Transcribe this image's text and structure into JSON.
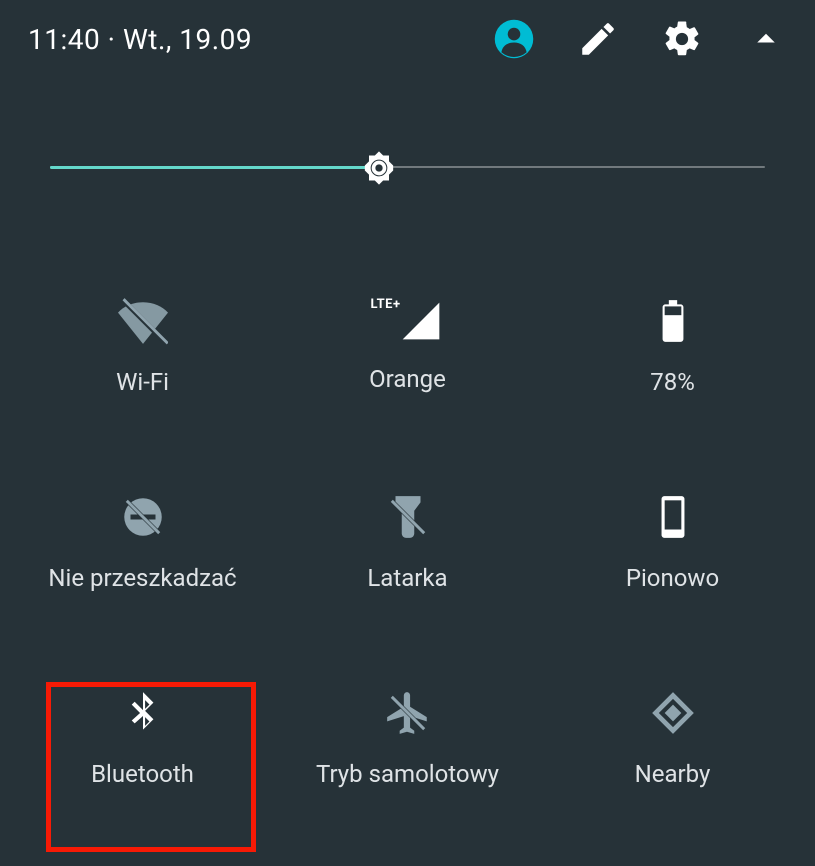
{
  "header": {
    "time": "11:40",
    "separator": " · ",
    "date": "Wt., 19.09"
  },
  "brightness": {
    "percent": 46
  },
  "tiles": [
    {
      "id": "wifi",
      "label": "Wi-Fi",
      "active": false
    },
    {
      "id": "cellular",
      "label": "Orange",
      "active": true,
      "network_badge": "LTE+"
    },
    {
      "id": "battery",
      "label": "78%",
      "active": true
    },
    {
      "id": "dnd",
      "label": "Nie przeszkadzać",
      "active": false
    },
    {
      "id": "flashlight",
      "label": "Latarka",
      "active": false
    },
    {
      "id": "rotation",
      "label": "Pionowo",
      "active": true
    },
    {
      "id": "bluetooth",
      "label": "Bluetooth",
      "active": true
    },
    {
      "id": "airplane",
      "label": "Tryb samolotowy",
      "active": false
    },
    {
      "id": "nearby",
      "label": "Nearby",
      "active": false
    }
  ],
  "annotation": {
    "highlighted_tile": "bluetooth"
  }
}
